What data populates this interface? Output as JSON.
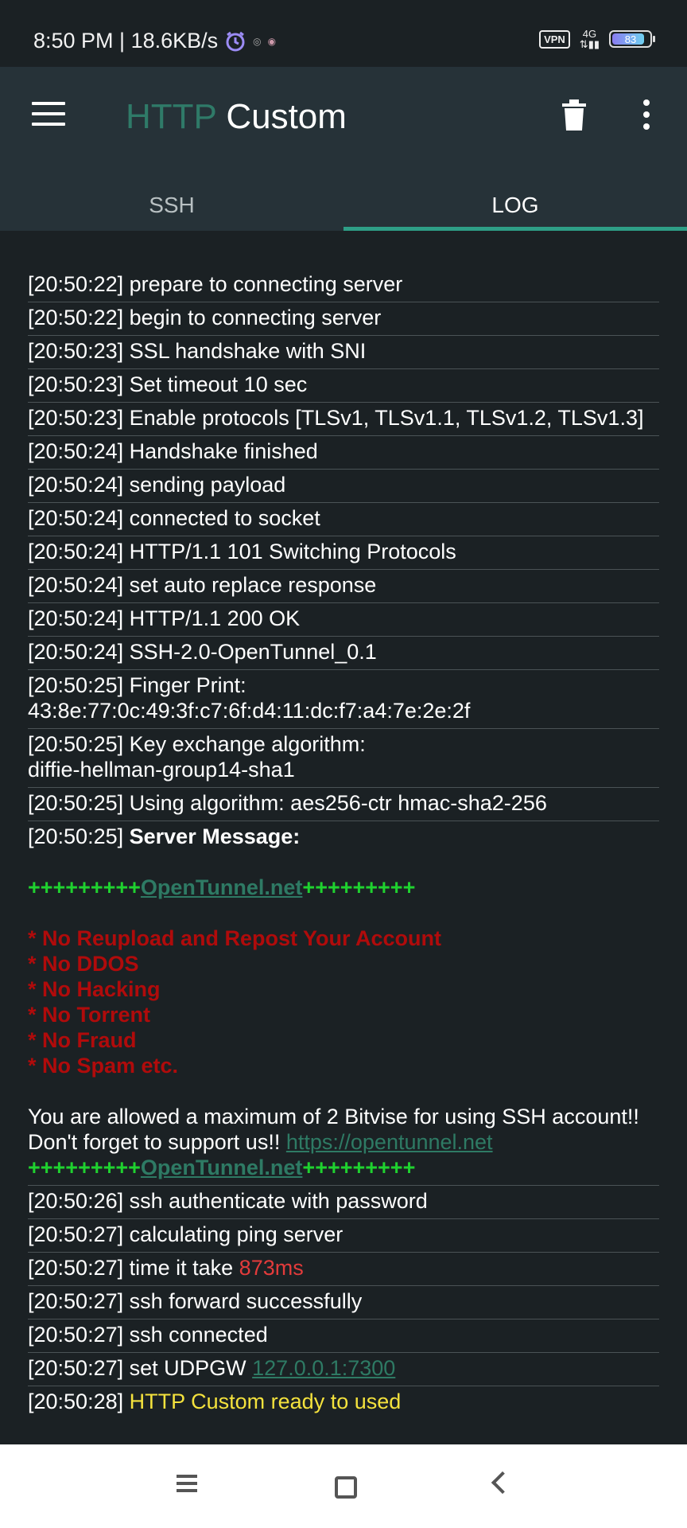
{
  "status_bar": {
    "time_speed": "8:50 PM | 18.6KB/s",
    "vpn": "VPN",
    "network": "4G",
    "battery": "83"
  },
  "app_bar": {
    "title_part1": "HTTP",
    "title_part2": "Custom",
    "menu_icon": "hamburger-menu-icon",
    "trash_icon": "trash-icon",
    "more_icon": "more-vert-icon"
  },
  "tabs": [
    {
      "label": "SSH",
      "active": false
    },
    {
      "label": "LOG",
      "active": true
    }
  ],
  "log": {
    "lines": [
      "[20:50:22] prepare to connecting server",
      "[20:50:22] begin to connecting server",
      "[20:50:23] SSL handshake with SNI",
      "[20:50:23] Set timeout 10 sec",
      "[20:50:23] Enable protocols [TLSv1, TLSv1.1, TLSv1.2, TLSv1.3]",
      "[20:50:24] Handshake finished",
      "[20:50:24] sending payload",
      "[20:50:24] connected to socket",
      "[20:50:24] HTTP/1.1 101 Switching Protocols",
      "[20:50:24] set auto replace response",
      "[20:50:24] HTTP/1.1 200 OK",
      "[20:50:24] SSH-2.0-OpenTunnel_0.1"
    ],
    "fingerprint_title": "[20:50:25] Finger Print:",
    "fingerprint_value": "43:8e:77:0c:49:3f:c7:6f:d4:11:dc:f7:a4:7e:2e:2f",
    "kex_title": "[20:50:25] Key exchange algorithm:",
    "kex_value": "diffie-hellman-group14-sha1",
    "algo_line": "[20:50:25] Using algorithm: aes256-ctr hmac-sha2-256",
    "server_msg_ts": "[20:50:25]",
    "server_msg_label": "Server Message:",
    "banner_plus": "+++++++++",
    "banner_link": "OpenTunnel.net",
    "rules": [
      "* No Reupload and Repost Your Account",
      "* No DDOS",
      "* No Hacking",
      "* No Torrent",
      "* No Fraud",
      "* No Spam etc."
    ],
    "allowed_text": "You are allowed a maximum of 2 Bitvise for using SSH account!!",
    "support_text": "Don't forget to support us!!",
    "support_link": "https://opentunnel.net",
    "auth_line": "[20:50:26] ssh authenticate with password",
    "ping_line": "[20:50:27] calculating ping server",
    "time_take_prefix": "[20:50:27] time it take",
    "time_take_value": "873ms",
    "forward_line": "[20:50:27] ssh forward successfully",
    "connected_line": "[20:50:27] ssh connected",
    "udpgw_prefix": "[20:50:27] set UDPGW",
    "udpgw_value": "127.0.0.1:7300",
    "ready_ts": "[20:50:28]",
    "ready_msg": "HTTP Custom ready to used"
  },
  "nav_bar": {
    "menu": "recents-icon",
    "home": "home-icon",
    "back": "back-icon"
  }
}
